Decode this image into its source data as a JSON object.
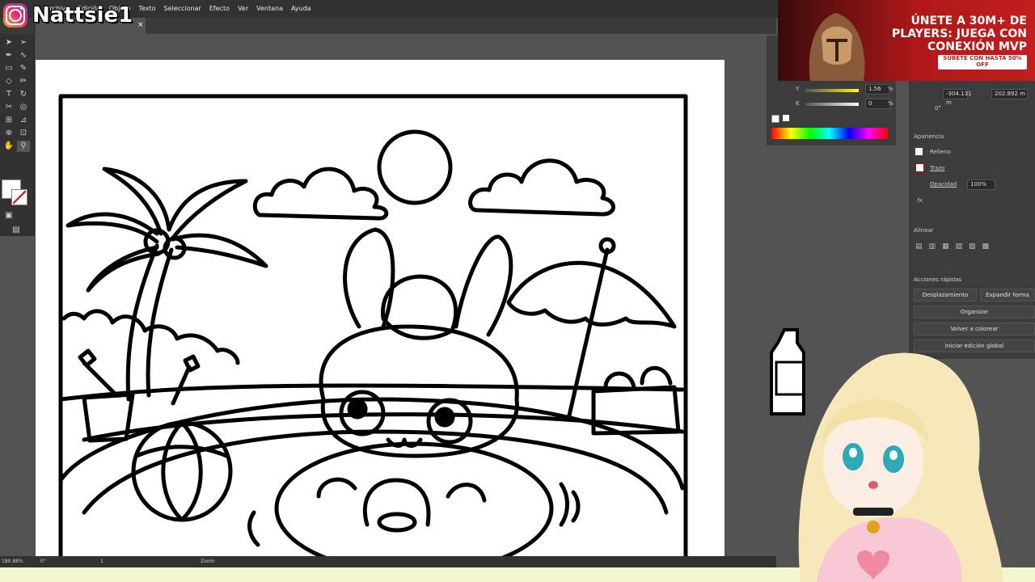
{
  "brand": {
    "name": "Nattsie1",
    "icon": "instagram-icon"
  },
  "menu": [
    "Archivo",
    "Edición",
    "Objeto",
    "Texto",
    "Seleccionar",
    "Efecto",
    "Ver",
    "Ventana",
    "Ayuda"
  ],
  "tab": {
    "close": "×"
  },
  "ad": {
    "headline": "ÚNETE A 30M+ DE PLAYERS: JUEGA CON CONEXIÓN MVP",
    "offer": "SÚBETE CON HASTA 50% OFF",
    "colors": {
      "bg": "#b01818",
      "text": "#ffffff"
    }
  },
  "color_panel": {
    "y_value": "1.56",
    "k_value": "0",
    "percent": "%"
  },
  "transform": {
    "y": "-304.131 m",
    "h": "202.892 m",
    "angle": "0°"
  },
  "appearance": {
    "title": "Apariencia",
    "fill_label": "Relleno",
    "stroke_label": "Trazo",
    "opacity_label": "Opacidad",
    "opacity_value": "100%",
    "fx": "fx."
  },
  "align": {
    "title": "Alinear"
  },
  "quick_actions": {
    "title": "Acciones rápidas",
    "offset": "Desplazamiento",
    "expand": "Expandir forma",
    "arrange": "Organizar",
    "recolor": "Volver a colorear",
    "global_edit": "Iniciar edición global"
  },
  "status": {
    "zoom_value": "180.88%",
    "angle": "0°",
    "page": "1",
    "tool": "Zoom"
  },
  "colors": {
    "ui_dark": "#323232",
    "ui_mid": "#535353",
    "panel": "#3c3c3c",
    "strip": "#f3f6cf"
  }
}
